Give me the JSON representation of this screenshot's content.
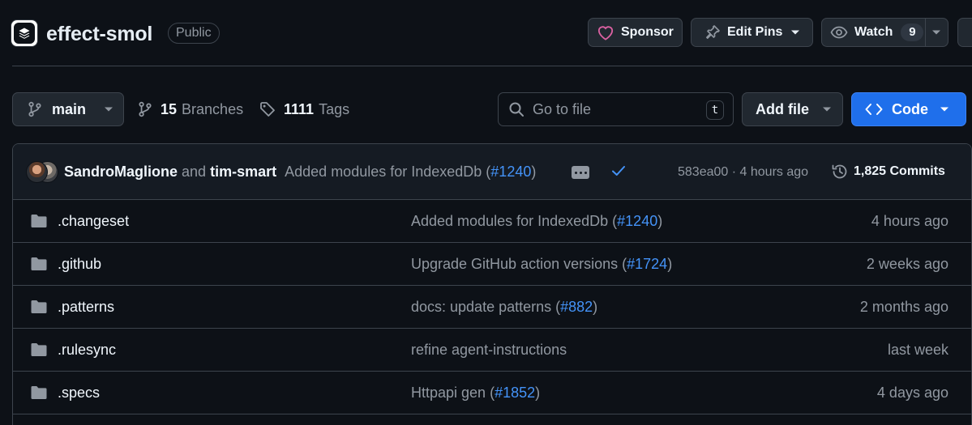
{
  "repo": {
    "name": "effect-smol",
    "visibility": "Public",
    "logo_icon": "stack-layers-icon"
  },
  "header_actions": {
    "sponsor_label": "Sponsor",
    "edit_pins_label": "Edit Pins",
    "watch_label": "Watch",
    "watch_count": "9",
    "colors": {
      "heart": "#db61a2",
      "button_bg": "#212830",
      "border": "#3d444d"
    }
  },
  "toolbar": {
    "branch": "main",
    "branches_count": "15",
    "branches_label": "Branches",
    "tags_count": "1111",
    "tags_label": "Tags",
    "search_placeholder": "Go to file",
    "search_shortcut": "t",
    "add_file_label": "Add file",
    "code_label": "Code",
    "accent": "#1f6feb"
  },
  "latest_commit": {
    "author1": "SandroMaglione",
    "and_label": "and",
    "author2": "tim-smart",
    "message": "Added modules for IndexedDb (",
    "pr": "#1240",
    "message_end": ")",
    "status": "success",
    "hash": "583ea00",
    "separator": "·",
    "time": "4 hours ago",
    "commits_label": "1,825 Commits"
  },
  "files": [
    {
      "name": ".changeset",
      "type": "folder",
      "msg": "Added modules for IndexedDb (",
      "pr": "#1240",
      "msg_end": ")",
      "time": "4 hours ago"
    },
    {
      "name": ".github",
      "type": "folder",
      "msg": "Upgrade GitHub action versions (",
      "pr": "#1724",
      "msg_end": ")",
      "time": "2 weeks ago"
    },
    {
      "name": ".patterns",
      "type": "folder",
      "msg": "docs: update patterns (",
      "pr": "#882",
      "msg_end": ")",
      "time": "2 months ago"
    },
    {
      "name": ".rulesync",
      "type": "folder",
      "msg": "refine agent-instructions",
      "pr": "",
      "msg_end": "",
      "time": "last week"
    },
    {
      "name": ".specs",
      "type": "folder",
      "msg": "Httpapi gen (",
      "pr": "#1852",
      "msg_end": ")",
      "time": "4 days ago"
    }
  ]
}
